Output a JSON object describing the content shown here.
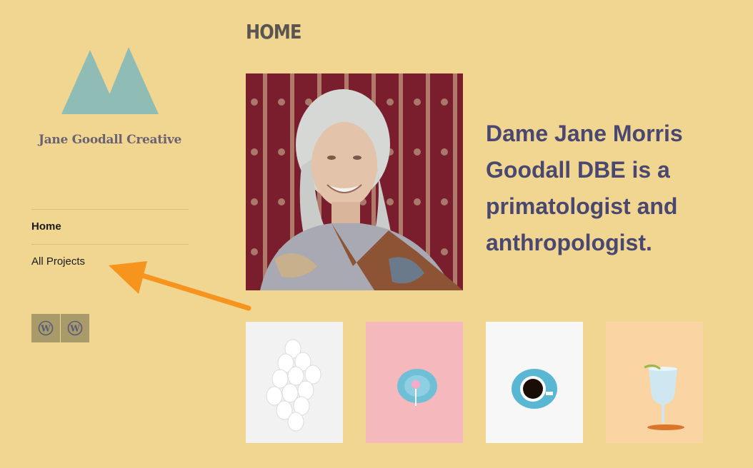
{
  "site": {
    "title": "Jane Goodall Creative"
  },
  "nav": {
    "items": [
      {
        "label": "Home",
        "active": true
      },
      {
        "label": "All Projects",
        "active": false
      }
    ]
  },
  "social": {
    "icons": [
      "wordpress-icon",
      "wordpress-icon"
    ]
  },
  "page": {
    "title": "HOME",
    "intro": "Dame Jane Morris Goodall DBE is a primatologist and anthropologist."
  },
  "gallery": {
    "thumbnails": [
      "eggs",
      "lollipop-on-plate",
      "coffee-cup",
      "glass"
    ]
  },
  "colors": {
    "background": "#f0d690",
    "logo": "#8fbcb5",
    "heading_text": "#4a4870",
    "annotation_arrow": "#f7941d"
  }
}
